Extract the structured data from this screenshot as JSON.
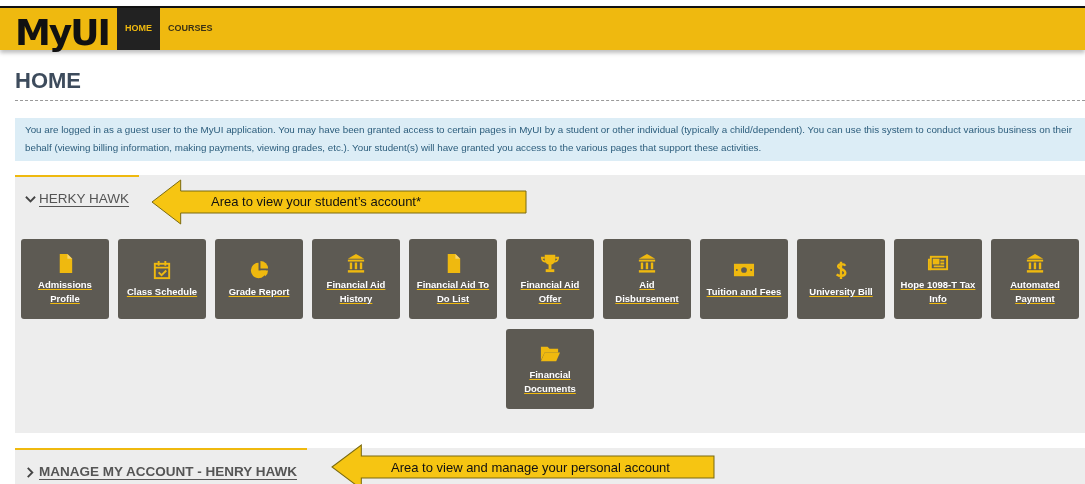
{
  "header": {
    "logo": "MyUI",
    "nav": [
      {
        "label": "HOME",
        "selected": true
      },
      {
        "label": "COURSES",
        "selected": false
      }
    ]
  },
  "page_title": "HOME",
  "notice": "You are logged in as a guest user to the MyUI application. You may have been granted access to certain pages in MyUI by a student or other individual (typically a child/dependent). You can use this system to conduct various business on their behalf (viewing billing information, making payments, viewing grades, etc.). Your student(s) will have granted you access to the various pages that support these activities.",
  "sections": [
    {
      "title": "HERKY HAWK",
      "expanded": true,
      "callout": "Area to view your student’s account*",
      "tiles": [
        {
          "label": "Admissions Profile",
          "kind": "document"
        },
        {
          "label": "Class Schedule",
          "kind": "calendar"
        },
        {
          "label": "Grade Report",
          "kind": "pie"
        },
        {
          "label": "Financial Aid History",
          "kind": "bank"
        },
        {
          "label": "Financial Aid To Do List",
          "kind": "document"
        },
        {
          "label": "Financial Aid Offer",
          "kind": "trophy"
        },
        {
          "label": "Aid Disbursement",
          "kind": "bank"
        },
        {
          "label": "Tuition and Fees",
          "kind": "money"
        },
        {
          "label": "University Bill",
          "kind": "dollar"
        },
        {
          "label": "Hope 1098-T Tax Info",
          "kind": "newspaper"
        },
        {
          "label": "Automated Payment",
          "kind": "bank"
        },
        {
          "label": "Financial Documents",
          "kind": "folder"
        }
      ]
    },
    {
      "title": "MANAGE MY ACCOUNT - HENRY HAWK",
      "expanded": false,
      "callout": "Area to view and manage your personal account"
    }
  ]
}
